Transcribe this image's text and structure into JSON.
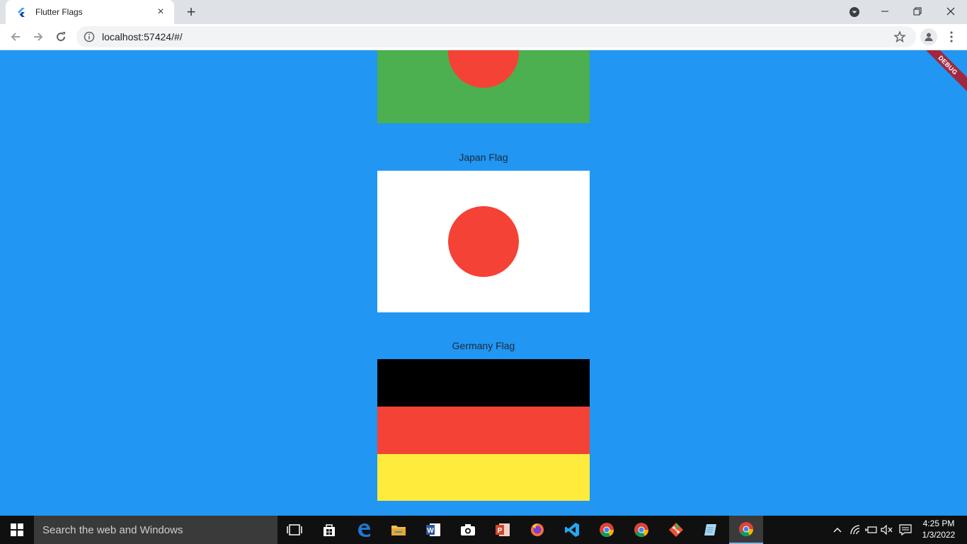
{
  "browser": {
    "tab_title": "Flutter Flags",
    "new_tab_symbol": "+",
    "close_symbol": "×",
    "url": "localhost:57424/#/"
  },
  "flags": [
    {
      "label": "",
      "type": "disc",
      "background": "#4caf50",
      "disc_color": "#f44336"
    },
    {
      "label": "Japan Flag",
      "type": "disc",
      "background": "#ffffff",
      "disc_color": "#f44336"
    },
    {
      "label": "Germany Flag",
      "type": "stripes",
      "stripes": [
        "#000000",
        "#f44336",
        "#ffeb3b"
      ]
    }
  ],
  "debug_banner": "DEBUG",
  "taskbar": {
    "search_placeholder": "Search the web and Windows",
    "icons": [
      "task-view-icon",
      "store-icon",
      "edge-icon",
      "file-explorer-icon",
      "word-icon",
      "camera-icon",
      "powerpoint-icon",
      "firefox-icon",
      "vscode-icon",
      "chrome-icon",
      "chrome-icon",
      "git-icon",
      "notepad-icon",
      "chrome-active-icon"
    ],
    "time": "4:25 PM",
    "date": "1/3/2022"
  },
  "colors": {
    "page_background": "#2196f3",
    "taskbar": "#101010",
    "tabstrip": "#dee1e6"
  }
}
